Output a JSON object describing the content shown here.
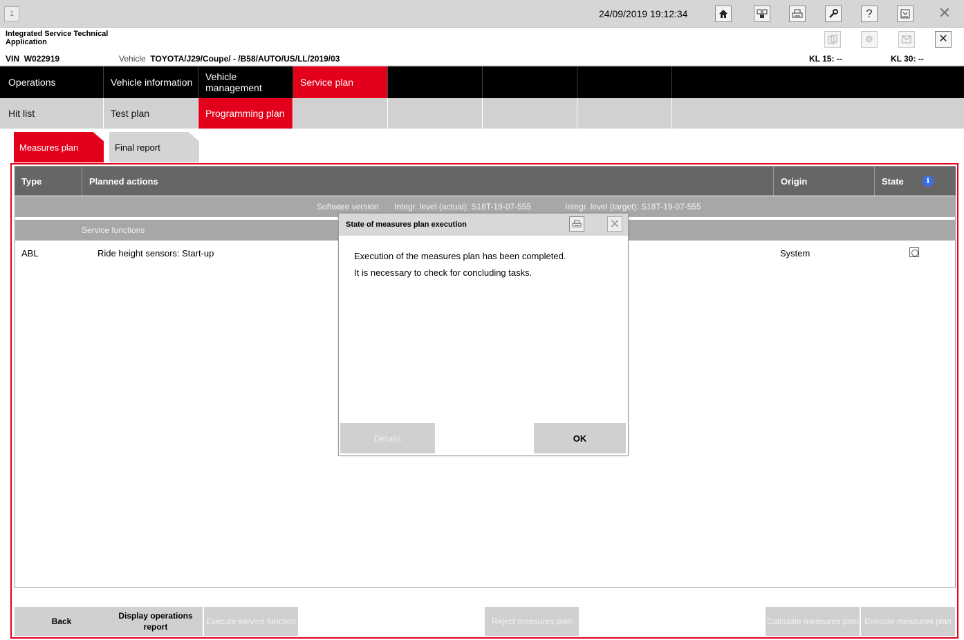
{
  "topbar": {
    "session_number": "1",
    "datetime": "24/09/2019 19:12:34",
    "icons": [
      "home-icon",
      "vehicle-diagnostics-icon",
      "print-icon",
      "wrench-icon",
      "help-icon",
      "minimize-icon",
      "close-icon"
    ]
  },
  "app": {
    "title": "Integrated Service Technical Application",
    "icons": [
      "copy-icon",
      "settings-icon",
      "mail-icon",
      "close-icon"
    ],
    "close_label": "✕"
  },
  "vehicle": {
    "vin_label": "VIN",
    "vin": "W022919",
    "vehicle_label": "Vehicle",
    "vehicle": "TOYOTA/J29/Coupe/ - /B58/AUTO/US/LL/2019/03",
    "kl15": "KL 15:  --",
    "kl30": "KL 30:  --"
  },
  "nav_main": [
    "Operations",
    "Vehicle information",
    "Vehicle management",
    "Service plan",
    "",
    "",
    "",
    ""
  ],
  "nav_sub": [
    "Hit list",
    "Test plan",
    "Programming plan",
    "",
    "",
    "",
    "",
    ""
  ],
  "subtabs": [
    "Measures plan",
    "Final report"
  ],
  "table": {
    "headers": {
      "type": "Type",
      "planned": "Planned actions",
      "origin": "Origin",
      "state": "State"
    },
    "software_row": {
      "label": "Software version",
      "actual": "Integr. level (actual): S18T-19-07-555",
      "target": "Integr. level (target): S18T-19-07-555"
    },
    "section": "Service functions",
    "rows": [
      {
        "type": "ABL",
        "action": "Ride height sensors: Start-up",
        "origin": "System"
      }
    ]
  },
  "buttons": {
    "back": "Back",
    "display_report": "Display operations report",
    "execute_service": "Execute service function",
    "reject_plan": "Reject measures plan",
    "calculate_plan": "Calculate measures plan",
    "execute_plan": "Execute measures plan"
  },
  "dialog": {
    "title": "State of measures plan execution",
    "line1": "Execution of the measures plan has been completed.",
    "line2": "It is necessary to check for concluding tasks.",
    "details": "Details",
    "ok": "OK"
  },
  "colors": {
    "accent": "#e2001a",
    "header": "#666666",
    "section": "#a7a7a7"
  }
}
